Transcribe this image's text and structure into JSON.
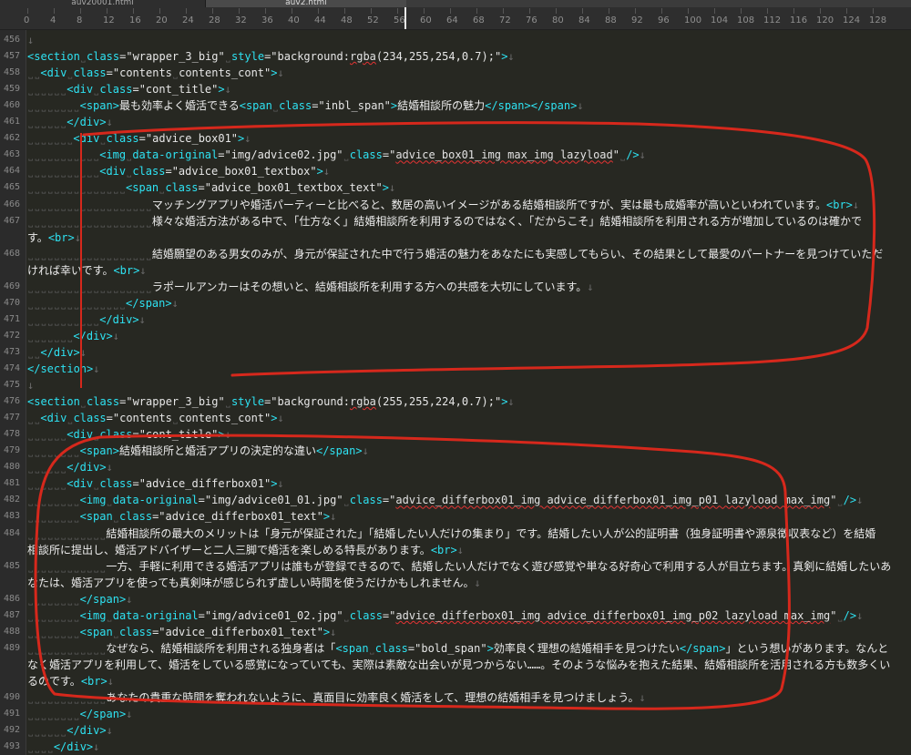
{
  "tabs": [
    "auv20001.html",
    "auv2.html"
  ],
  "ruler": [
    "0",
    "4",
    "8",
    "12",
    "16",
    "20",
    "24",
    "28",
    "32",
    "36",
    "40",
    "44",
    "48",
    "52",
    "56",
    "60",
    "64",
    "68",
    "72",
    "76",
    "80",
    "84",
    "88",
    "92",
    "96",
    "100",
    "104",
    "108",
    "112",
    "116",
    "120",
    "124",
    "128"
  ],
  "lines": [
    {
      "n": "456",
      "t": [
        [
          "mk",
          "↓"
        ]
      ]
    },
    {
      "n": "457",
      "t": [
        [
          "tag",
          "<section"
        ],
        [
          "ind",
          "˽"
        ],
        [
          "attr",
          "class"
        ],
        [
          "eq",
          "="
        ],
        [
          "str",
          "\"wrapper_3_big\""
        ],
        [
          "ind",
          "˽"
        ],
        [
          "attr",
          "style"
        ],
        [
          "eq",
          "="
        ],
        [
          "str",
          "\"background:"
        ],
        [
          "wav",
          "rgba"
        ],
        [
          "str",
          "(234,255,254,0.7);\""
        ],
        [
          "tag",
          ">"
        ],
        [
          "mk",
          "↓"
        ]
      ]
    },
    {
      "n": "458",
      "t": [
        [
          "ind",
          "˽˽"
        ],
        [
          "tag",
          "<div"
        ],
        [
          "ind",
          "˽"
        ],
        [
          "attr",
          "class"
        ],
        [
          "eq",
          "="
        ],
        [
          "str",
          "\"contents"
        ],
        [
          "ind",
          "˽"
        ],
        [
          "str",
          "contents_cont\""
        ],
        [
          "tag",
          ">"
        ],
        [
          "mk",
          "↓"
        ]
      ]
    },
    {
      "n": "459",
      "t": [
        [
          "ind",
          "˽˽˽˽˽˽"
        ],
        [
          "tag",
          "<div"
        ],
        [
          "ind",
          "˽"
        ],
        [
          "attr",
          "class"
        ],
        [
          "eq",
          "="
        ],
        [
          "str",
          "\"cont_title\""
        ],
        [
          "tag",
          ">"
        ],
        [
          "mk",
          "↓"
        ]
      ]
    },
    {
      "n": "460",
      "t": [
        [
          "ind",
          "˽˽˽˽˽˽˽˽"
        ],
        [
          "tag",
          "<span>"
        ],
        [
          "txt",
          "最も効率よく婚活できる"
        ],
        [
          "tag",
          "<span"
        ],
        [
          "ind",
          "˽"
        ],
        [
          "attr",
          "class"
        ],
        [
          "eq",
          "="
        ],
        [
          "str",
          "\"inbl_span\""
        ],
        [
          "tag",
          ">"
        ],
        [
          "txt",
          "結婚相談所の魅力"
        ],
        [
          "tag",
          "</span></span>"
        ],
        [
          "mk",
          "↓"
        ]
      ]
    },
    {
      "n": "461",
      "t": [
        [
          "ind",
          "˽˽˽˽˽˽"
        ],
        [
          "tag",
          "</div>"
        ],
        [
          "mk",
          "↓"
        ]
      ]
    },
    {
      "n": "462",
      "t": [
        [
          "ind",
          "˽˽˽˽˽˽˽"
        ],
        [
          "tag",
          "<div"
        ],
        [
          "ind",
          "˽"
        ],
        [
          "attr",
          "class"
        ],
        [
          "eq",
          "="
        ],
        [
          "str",
          "\"advice_box01\""
        ],
        [
          "tag",
          ">"
        ],
        [
          "mk",
          "↓"
        ]
      ]
    },
    {
      "n": "463",
      "t": [
        [
          "ind",
          "˽˽˽˽˽˽˽˽˽˽˽"
        ],
        [
          "tag",
          "<img"
        ],
        [
          "ind",
          "˽"
        ],
        [
          "attr",
          "data-original"
        ],
        [
          "eq",
          "="
        ],
        [
          "str",
          "\"img/advice02.jpg\""
        ],
        [
          "ind",
          "˽"
        ],
        [
          "attr",
          "class"
        ],
        [
          "eq",
          "="
        ],
        [
          "str",
          "\""
        ],
        [
          "wav",
          "advice_box01_img max_img lazyload"
        ],
        [
          "str",
          "\""
        ],
        [
          "ind",
          "˽"
        ],
        [
          "tag",
          "/>"
        ],
        [
          "mk",
          "↓"
        ]
      ]
    },
    {
      "n": "464",
      "t": [
        [
          "ind",
          "˽˽˽˽˽˽˽˽˽˽˽"
        ],
        [
          "tag",
          "<div"
        ],
        [
          "ind",
          "˽"
        ],
        [
          "attr",
          "class"
        ],
        [
          "eq",
          "="
        ],
        [
          "str",
          "\"advice_box01_textbox\""
        ],
        [
          "tag",
          ">"
        ],
        [
          "mk",
          "↓"
        ]
      ]
    },
    {
      "n": "465",
      "t": [
        [
          "ind",
          "˽˽˽˽˽˽˽˽˽˽˽˽˽˽˽"
        ],
        [
          "tag",
          "<span"
        ],
        [
          "ind",
          "˽"
        ],
        [
          "attr",
          "class"
        ],
        [
          "eq",
          "="
        ],
        [
          "str",
          "\"advice_box01_textbox_text\""
        ],
        [
          "tag",
          ">"
        ],
        [
          "mk",
          "↓"
        ]
      ]
    },
    {
      "n": "466",
      "t": [
        [
          "ind",
          "˽˽˽˽˽˽˽˽˽˽˽˽˽˽˽˽˽˽˽"
        ],
        [
          "txt",
          "マッチングアプリや婚活パーティーと比べると、数居の高いイメージがある結婚相談所ですが、実は最も成婚率が高いといわれています。"
        ],
        [
          "tag",
          "<br>"
        ],
        [
          "mk",
          "↓"
        ]
      ]
    },
    {
      "n": "467",
      "t": [
        [
          "ind",
          "˽˽˽˽˽˽˽˽˽˽˽˽˽˽˽˽˽˽˽"
        ],
        [
          "txt",
          "様々な婚活方法がある中で、「仕方なく」結婚相談所を利用するのではなく、「だからこそ」結婚相談所を利用される方が増加しているのは確かで"
        ]
      ]
    },
    {
      "n": "",
      "t": [
        [
          "txt",
          "す。"
        ],
        [
          "tag",
          "<br>"
        ],
        [
          "mk",
          "↓"
        ]
      ]
    },
    {
      "n": "468",
      "t": [
        [
          "ind",
          "˽˽˽˽˽˽˽˽˽˽˽˽˽˽˽˽˽˽˽"
        ],
        [
          "txt",
          "結婚願望のある男女のみが、身元が保証された中で行う婚活の魅力をあなたにも実感してもらい、その結果として最愛のパートナーを見つけていただ"
        ]
      ]
    },
    {
      "n": "",
      "t": [
        [
          "txt",
          "ければ幸いです。"
        ],
        [
          "tag",
          "<br>"
        ],
        [
          "mk",
          "↓"
        ]
      ]
    },
    {
      "n": "469",
      "t": [
        [
          "ind",
          "˽˽˽˽˽˽˽˽˽˽˽˽˽˽˽˽˽˽˽"
        ],
        [
          "txt",
          "ラポールアンカーはその想いと、結婚相談所を利用する方への共感を大切にしています。"
        ],
        [
          "mk",
          "↓"
        ]
      ]
    },
    {
      "n": "470",
      "t": [
        [
          "ind",
          "˽˽˽˽˽˽˽˽˽˽˽˽˽˽˽"
        ],
        [
          "tag",
          "</span>"
        ],
        [
          "mk",
          "↓"
        ]
      ]
    },
    {
      "n": "471",
      "t": [
        [
          "ind",
          "˽˽˽˽˽˽˽˽˽˽˽"
        ],
        [
          "tag",
          "</div>"
        ],
        [
          "mk",
          "↓"
        ]
      ]
    },
    {
      "n": "472",
      "t": [
        [
          "ind",
          "˽˽˽˽˽˽˽"
        ],
        [
          "tag",
          "</div>"
        ],
        [
          "mk",
          "↓"
        ]
      ]
    },
    {
      "n": "473",
      "t": [
        [
          "ind",
          "˽˽"
        ],
        [
          "tag",
          "</div>"
        ],
        [
          "mk",
          "↓"
        ]
      ]
    },
    {
      "n": "474",
      "t": [
        [
          "tag",
          "</section>"
        ],
        [
          "mk",
          "↓"
        ]
      ]
    },
    {
      "n": "475",
      "t": [
        [
          "mk",
          "↓"
        ]
      ]
    },
    {
      "n": "476",
      "t": [
        [
          "tag",
          "<section"
        ],
        [
          "ind",
          "˽"
        ],
        [
          "attr",
          "class"
        ],
        [
          "eq",
          "="
        ],
        [
          "str",
          "\"wrapper_3_big\""
        ],
        [
          "ind",
          "˽"
        ],
        [
          "attr",
          "style"
        ],
        [
          "eq",
          "="
        ],
        [
          "str",
          "\"background:"
        ],
        [
          "wav",
          "rgba"
        ],
        [
          "str",
          "(255,255,224,0.7);\""
        ],
        [
          "tag",
          ">"
        ],
        [
          "mk",
          "↓"
        ]
      ]
    },
    {
      "n": "477",
      "t": [
        [
          "ind",
          "˽˽"
        ],
        [
          "tag",
          "<div"
        ],
        [
          "ind",
          "˽"
        ],
        [
          "attr",
          "class"
        ],
        [
          "eq",
          "="
        ],
        [
          "str",
          "\"contents"
        ],
        [
          "ind",
          "˽"
        ],
        [
          "str",
          "contents_cont\""
        ],
        [
          "tag",
          ">"
        ],
        [
          "mk",
          "↓"
        ]
      ]
    },
    {
      "n": "478",
      "t": [
        [
          "ind",
          "˽˽˽˽˽˽"
        ],
        [
          "tag",
          "<div"
        ],
        [
          "ind",
          "˽"
        ],
        [
          "attr",
          "class"
        ],
        [
          "eq",
          "="
        ],
        [
          "str",
          "\"cont_title\""
        ],
        [
          "tag",
          ">"
        ],
        [
          "mk",
          "↓"
        ]
      ]
    },
    {
      "n": "479",
      "t": [
        [
          "ind",
          "˽˽˽˽˽˽˽˽"
        ],
        [
          "tag",
          "<span>"
        ],
        [
          "txt",
          "結婚相談所と婚活アプリの決定的な違い"
        ],
        [
          "tag",
          "</span>"
        ],
        [
          "mk",
          "↓"
        ]
      ]
    },
    {
      "n": "480",
      "t": [
        [
          "ind",
          "˽˽˽˽˽˽"
        ],
        [
          "tag",
          "</div>"
        ],
        [
          "mk",
          "↓"
        ]
      ]
    },
    {
      "n": "481",
      "t": [
        [
          "ind",
          "˽˽˽˽˽˽"
        ],
        [
          "tag",
          "<div"
        ],
        [
          "ind",
          "˽"
        ],
        [
          "attr",
          "class"
        ],
        [
          "eq",
          "="
        ],
        [
          "str",
          "\"advice_differbox01\""
        ],
        [
          "tag",
          ">"
        ],
        [
          "mk",
          "↓"
        ]
      ]
    },
    {
      "n": "482",
      "t": [
        [
          "ind",
          "˽˽˽˽˽˽˽˽"
        ],
        [
          "tag",
          "<img"
        ],
        [
          "ind",
          "˽"
        ],
        [
          "attr",
          "data-original"
        ],
        [
          "eq",
          "="
        ],
        [
          "str",
          "\"img/advice01_01.jpg\""
        ],
        [
          "ind",
          "˽"
        ],
        [
          "attr",
          "class"
        ],
        [
          "eq",
          "="
        ],
        [
          "str",
          "\""
        ],
        [
          "wav",
          "advice_differbox01_img advice_differbox01_img_p01 lazyload max_img"
        ],
        [
          "str",
          "\""
        ],
        [
          "ind",
          "˽"
        ],
        [
          "tag",
          "/>"
        ],
        [
          "mk",
          "↓"
        ]
      ]
    },
    {
      "n": "483",
      "t": [
        [
          "ind",
          "˽˽˽˽˽˽˽˽"
        ],
        [
          "tag",
          "<span"
        ],
        [
          "ind",
          "˽"
        ],
        [
          "attr",
          "class"
        ],
        [
          "eq",
          "="
        ],
        [
          "str",
          "\"advice_differbox01_text\""
        ],
        [
          "tag",
          ">"
        ],
        [
          "mk",
          "↓"
        ]
      ]
    },
    {
      "n": "484",
      "t": [
        [
          "ind",
          "˽˽˽˽˽˽˽˽˽˽˽˽"
        ],
        [
          "txt",
          "結婚相談所の最大のメリットは「身元が保証された」「結婚したい人だけの集まり」です。結婚したい人が公的証明書（独身証明書や源泉徴収表など）を結婚"
        ]
      ]
    },
    {
      "n": "",
      "t": [
        [
          "txt",
          "相談所に提出し、婚活アドバイザーと二人三脚で婚活を楽しめる特長があります。"
        ],
        [
          "tag",
          "<br>"
        ],
        [
          "mk",
          "↓"
        ]
      ]
    },
    {
      "n": "485",
      "t": [
        [
          "ind",
          "˽˽˽˽˽˽˽˽˽˽˽˽"
        ],
        [
          "txt",
          "一方、手軽に利用できる婚活アプリは誰もが登録できるので、結婚したい人だけでなく遊び感覚や単なる好奇心で利用する人が目立ちます。真剣に結婚したいあ"
        ]
      ]
    },
    {
      "n": "",
      "t": [
        [
          "txt",
          "なたは、婚活アプリを使っても真剣味が感じられず虚しい時間を使うだけかもしれません。"
        ],
        [
          "mk",
          "↓"
        ]
      ]
    },
    {
      "n": "486",
      "t": [
        [
          "ind",
          "˽˽˽˽˽˽˽˽"
        ],
        [
          "tag",
          "</span>"
        ],
        [
          "mk",
          "↓"
        ]
      ]
    },
    {
      "n": "487",
      "t": [
        [
          "ind",
          "˽˽˽˽˽˽˽˽"
        ],
        [
          "tag",
          "<img"
        ],
        [
          "ind",
          "˽"
        ],
        [
          "attr",
          "data-original"
        ],
        [
          "eq",
          "="
        ],
        [
          "str",
          "\"img/advice01_02.jpg\""
        ],
        [
          "ind",
          "˽"
        ],
        [
          "attr",
          "class"
        ],
        [
          "eq",
          "="
        ],
        [
          "str",
          "\""
        ],
        [
          "wav",
          "advice_differbox01_img advice_differbox01_img_p02 lazyload max_img"
        ],
        [
          "str",
          "\""
        ],
        [
          "ind",
          "˽"
        ],
        [
          "tag",
          "/>"
        ],
        [
          "mk",
          "↓"
        ]
      ]
    },
    {
      "n": "488",
      "t": [
        [
          "ind",
          "˽˽˽˽˽˽˽˽"
        ],
        [
          "tag",
          "<span"
        ],
        [
          "ind",
          "˽"
        ],
        [
          "attr",
          "class"
        ],
        [
          "eq",
          "="
        ],
        [
          "str",
          "\"advice_differbox01_text\""
        ],
        [
          "tag",
          ">"
        ],
        [
          "mk",
          "↓"
        ]
      ]
    },
    {
      "n": "489",
      "t": [
        [
          "ind",
          "˽˽˽˽˽˽˽˽˽˽˽˽"
        ],
        [
          "txt",
          "なぜなら、結婚相談所を利用される独身者は「"
        ],
        [
          "tag",
          "<span"
        ],
        [
          "ind",
          "˽"
        ],
        [
          "attr",
          "class"
        ],
        [
          "eq",
          "="
        ],
        [
          "str",
          "\"bold_span\""
        ],
        [
          "tag",
          ">"
        ],
        [
          "txt",
          "効率良く理想の結婚相手を見つけたい"
        ],
        [
          "tag",
          "</span>"
        ],
        [
          "txt",
          "」という想いがあります。なんと"
        ]
      ]
    },
    {
      "n": "",
      "t": [
        [
          "txt",
          "なく婚活アプリを利用して、婚活をしている感覚になっていても、実際は素敵な出会いが見つからない……。そのような悩みを抱えた結果、結婚相談所を活用される方も数多くい"
        ]
      ]
    },
    {
      "n": "",
      "t": [
        [
          "txt",
          "るのです。"
        ],
        [
          "tag",
          "<br>"
        ],
        [
          "mk",
          "↓"
        ]
      ]
    },
    {
      "n": "490",
      "t": [
        [
          "ind",
          "˽˽˽˽˽˽˽˽˽˽˽˽"
        ],
        [
          "txt",
          "あなたの貴重な時間を奪われないように、真面目に効率良く婚活をして、理想の結婚相手を見つけましょう。"
        ],
        [
          "mk",
          "↓"
        ]
      ]
    },
    {
      "n": "491",
      "t": [
        [
          "ind",
          "˽˽˽˽˽˽˽˽"
        ],
        [
          "tag",
          "</span>"
        ],
        [
          "mk",
          "↓"
        ]
      ]
    },
    {
      "n": "492",
      "t": [
        [
          "ind",
          "˽˽˽˽˽˽"
        ],
        [
          "tag",
          "</div>"
        ],
        [
          "mk",
          "↓"
        ]
      ]
    },
    {
      "n": "493",
      "t": [
        [
          "ind",
          "˽˽˽˽"
        ],
        [
          "tag",
          "</div>"
        ],
        [
          "mk",
          "↓"
        ]
      ]
    }
  ],
  "colors": {
    "annotation": "#d6281c",
    "tag": "#2ee2f2",
    "background": "#272822"
  }
}
